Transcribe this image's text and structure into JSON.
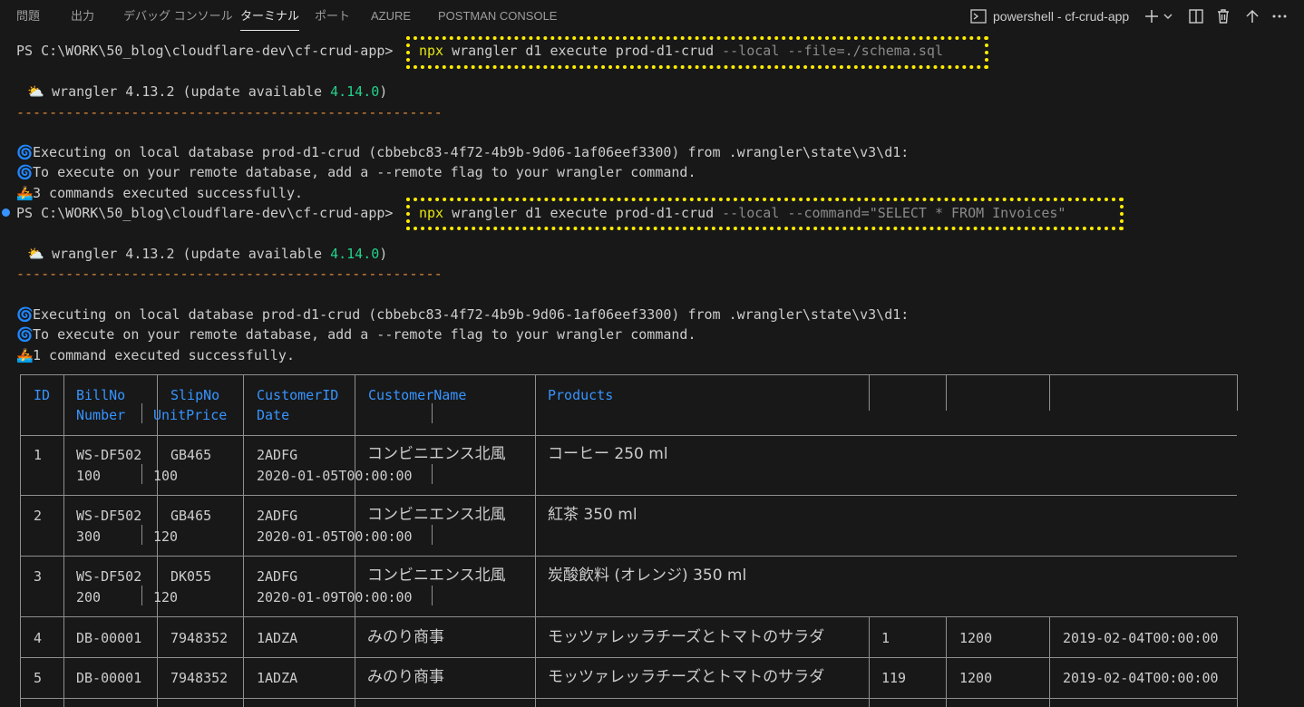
{
  "tabs": [
    "問題",
    "出力",
    "デバッグ コンソール",
    "ターミナル",
    "ポート",
    "AZURE",
    "POSTMAN CONSOLE"
  ],
  "active_tab": "ターミナル",
  "terminal_title": "powershell - cf-crud-app",
  "icons": [
    "terminal-icon",
    "plus-icon",
    "chevron-down-icon",
    "split-icon",
    "trash-icon",
    "maximize-icon",
    "more-icon"
  ],
  "prompt": "PS C:\\WORK\\50_blog\\cloudflare-dev\\cf-crud-app>",
  "cmd1": {
    "npx": "npx",
    "main": " wrangler d1 execute prod-d1-crud",
    "args": " --local --file=./schema.sql"
  },
  "cmd2": {
    "npx": "npx",
    "main": " wrangler d1 execute prod-d1-crud",
    "args": " --local --command=\"SELECT * FROM Invoices\""
  },
  "wrangler_version": " wrangler 4.13.2 (update available ",
  "wrangler_new": "4.14.0",
  "wrangler_close": ")",
  "divider": "----------------------------------------------------",
  "exec_local": "Executing on local database prod-d1-crud (cbbebc83-4f72-4b9b-9d06-1af06eef3300) from .wrangler\\state\\v3\\d1:",
  "exec_remote": "To execute on your remote database, add a --remote flag to your wrangler command.",
  "success1": "3 commands executed successfully.",
  "success2": "1 command executed successfully.",
  "table": {
    "headers_row1": [
      "ID",
      "BillNo",
      "SlipNo",
      "CustomerID",
      "CustomerName",
      "Products"
    ],
    "headers_row2": [
      "Number",
      "UnitPrice",
      "Date"
    ],
    "rows": [
      {
        "id": "1",
        "bill": "WS-DF502",
        "slip": "GB465",
        "cust": "2ADFG",
        "name": "コンビニエンス北風",
        "product": "コーヒー 250 ml",
        "num": "100",
        "price": "100",
        "date": "2020-01-05T00:00:00"
      },
      {
        "id": "2",
        "bill": "WS-DF502",
        "slip": "GB465",
        "cust": "2ADFG",
        "name": "コンビニエンス北風",
        "product": "紅茶 350 ml",
        "num": "300",
        "price": "120",
        "date": "2020-01-05T00:00:00"
      },
      {
        "id": "3",
        "bill": "WS-DF502",
        "slip": "DK055",
        "cust": "2ADFG",
        "name": "コンビニエンス北風",
        "product": "炭酸飲料 (オレンジ) 350 ml",
        "num": "200",
        "price": "120",
        "date": "2020-01-09T00:00:00"
      },
      {
        "id": "4",
        "bill": "DB-00001",
        "slip": "7948352",
        "cust": "1ADZA",
        "name": "みのり商事",
        "product": "モッツァレッラチーズとトマトのサラダ",
        "num": "1",
        "price": "1200",
        "date": "2019-02-04T00:00:00"
      },
      {
        "id": "5",
        "bill": "DB-00001",
        "slip": "7948352",
        "cust": "1ADZA",
        "name": "みのり商事",
        "product": "モッツァレッラチーズとトマトのサラダ",
        "num": "119",
        "price": "1200",
        "date": "2019-02-04T00:00:00"
      }
    ]
  }
}
